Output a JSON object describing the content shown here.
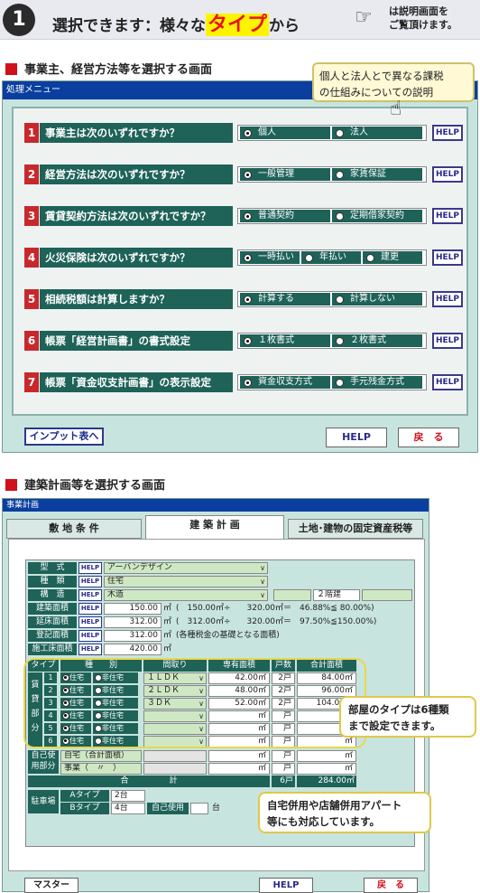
{
  "header": {
    "number": "1",
    "title_pre": "選択できます：様々な",
    "title_kw": "タイプ",
    "title_post": "から",
    "note": "は説明画面を\nご覧頂けます。"
  },
  "section1": {
    "title": "事業主、経営方法等を選択する画面"
  },
  "window1": {
    "titlebar": "処理メニュー",
    "callout": "個人と法人とで異なる課税\nの仕組みについての説明",
    "help_label": "HELP",
    "questions": [
      {
        "num": "1",
        "text": "事業主は次のいずれですか？",
        "options": [
          "個人",
          "法人"
        ],
        "selected": 0
      },
      {
        "num": "2",
        "text": "経営方法は次のいずれですか？",
        "options": [
          "一般管理",
          "家賃保証"
        ],
        "selected": 0
      },
      {
        "num": "3",
        "text": "賃貸契約方法は次のいずれですか？",
        "options": [
          "普通契約",
          "定期借家契約"
        ],
        "selected": 0
      },
      {
        "num": "4",
        "text": "火災保険は次のいずれですか？",
        "options": [
          "一時払い",
          "年払い",
          "建更"
        ],
        "selected": 0
      },
      {
        "num": "5",
        "text": "相続税額は計算しますか？",
        "options": [
          "計算する",
          "計算しない"
        ],
        "selected": 0
      },
      {
        "num": "6",
        "text": "帳票「経営計画書」の書式設定",
        "options": [
          "１枚書式",
          "２枚書式"
        ],
        "selected": 0
      },
      {
        "num": "7",
        "text": "帳票「資金収支計画書」の表示設定",
        "options": [
          "資金収支方式",
          "手元残金方式"
        ],
        "selected": 0
      }
    ],
    "bottom": {
      "input_table": "インプット表へ",
      "help": "HELP",
      "back": "戻　る"
    }
  },
  "section2": {
    "title": "建築計画等を選択する画面"
  },
  "window2": {
    "titlebar": "事業計画",
    "tabs": [
      "敷 地 条 件",
      "建 築 計 画",
      "土地･建物の固定資産税等"
    ],
    "active_tab": 1,
    "help_small": "HELP",
    "fields": {
      "form_label": "型　式",
      "form_value": "アーバンデザイン",
      "kind_label": "種　類",
      "kind_value": "住宅",
      "struct_label": "構　造",
      "struct_value": "木造",
      "floors": "２階建",
      "build_area_label": "建築面積",
      "build_area_value": "150.00",
      "build_area_calc": "(　150.00㎡÷　　320.00㎡＝　46.88%≦ 80.00%)",
      "floor_area_label": "延床面積",
      "floor_area_value": "312.00",
      "floor_area_calc": "(　312.00㎡÷　　320.00㎡＝　97.50%≦150.00%)",
      "reg_area_label": "登記面積",
      "reg_area_value": "312.00",
      "reg_area_note": "(各種税金の基礎となる面積)",
      "const_area_label": "施工床面積",
      "const_area_value": "420.00",
      "unit": "㎡"
    },
    "table": {
      "headers": [
        "タイプ",
        "種　　別",
        "間取り",
        "専有面積",
        "戸数",
        "合計面積"
      ],
      "side_label": "賃貸部分",
      "res": "住宅",
      "nonres": "非住宅",
      "rows": [
        {
          "n": "1",
          "layout": "１ＬＤＫ",
          "area": "42.00",
          "count": "2",
          "total": "84.00"
        },
        {
          "n": "2",
          "layout": "２ＬＤＫ",
          "area": "48.00",
          "count": "2",
          "total": "96.00"
        },
        {
          "n": "3",
          "layout": "３ＤＫ",
          "area": "52.00",
          "count": "2",
          "total": "104.00"
        },
        {
          "n": "4",
          "layout": "",
          "area": "",
          "count": "",
          "total": ""
        },
        {
          "n": "5",
          "layout": "",
          "area": "",
          "count": "",
          "total": ""
        },
        {
          "n": "6",
          "layout": "",
          "area": "",
          "count": "",
          "total": ""
        }
      ],
      "unit_m2": "㎡",
      "unit_ko": "戸",
      "self_use_label": "自己使用部分",
      "self_home": "自宅（合計面積）",
      "self_biz": "事業（　〃　）",
      "total_label": "合　　　　　計",
      "total_count": "6",
      "total_area": "284.00",
      "parking_label": "駐車場",
      "a_type": "Aタイプ",
      "a_count": "2台",
      "b_type": "Bタイプ",
      "b_count": "4台",
      "self_use_btn": "自己使用",
      "unit_dai": "台"
    },
    "callout_types": "部屋のタイプは6種類\nまで設定できます。",
    "callout_mixed": "自宅併用や店舗併用アパート\n等にも対応しています。",
    "bottom": {
      "master": "マスター",
      "help": "HELP",
      "back": "戻　る"
    }
  }
}
